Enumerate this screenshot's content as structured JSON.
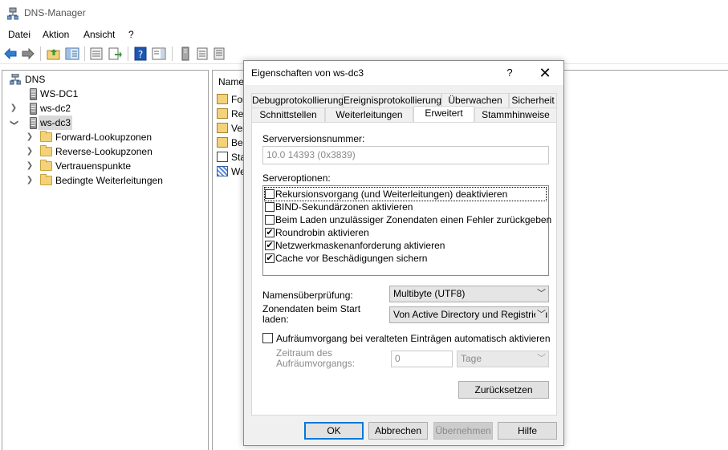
{
  "app": {
    "title": "DNS-Manager",
    "icon": "dns-manager-icon"
  },
  "menu": [
    "Datei",
    "Aktion",
    "Ansicht",
    "?"
  ],
  "toolbar": {
    "icons": [
      "back-arrow-icon",
      "forward-arrow-icon",
      "up-folder-icon",
      "show-hide-tree-icon",
      "properties-icon",
      "export-list-icon",
      "help-icon",
      "action-pane-icon",
      "server-icon",
      "records-icon",
      "list-icon"
    ]
  },
  "tree": {
    "root": "DNS",
    "servers": [
      "WS-DC1",
      "ws-dc2",
      "ws-dc3"
    ],
    "children": [
      "Forward-Lookupzonen",
      "Reverse-Lookupzonen",
      "Vertrauenspunkte",
      "Bedingte Weiterleitungen"
    ]
  },
  "list": {
    "header": "Name",
    "items": [
      "For",
      "Rev",
      "Ver",
      "Bed",
      "Sta",
      "We"
    ]
  },
  "dialog": {
    "title": "Eigenschaften von ws-dc3",
    "help": "?",
    "close": "✕",
    "tabs_row1": [
      "Debugprotokollierung",
      "Ereignisprotokollierung",
      "Überwachen",
      "Sicherheit"
    ],
    "tabs_row2": [
      "Schnittstellen",
      "Weiterleitungen",
      "Erweitert",
      "Stammhinweise"
    ],
    "active_tab": "Erweitert",
    "server_version_label": "Serverversionsnummer:",
    "server_version_value": "10.0 14393 (0x3839)",
    "server_options_label": "Serveroptionen:",
    "options": [
      {
        "label": "Rekursionsvorgang (und Weiterleitungen) deaktivieren",
        "checked": false
      },
      {
        "label": "BIND-Sekundärzonen aktivieren",
        "checked": false
      },
      {
        "label": "Beim Laden unzulässiger Zonendaten einen Fehler zurückgeben",
        "checked": false
      },
      {
        "label": "Roundrobin aktivieren",
        "checked": true
      },
      {
        "label": "Netzwerkmaskenanforderung aktivieren",
        "checked": true
      },
      {
        "label": "Cache vor Beschädigungen sichern",
        "checked": true
      }
    ],
    "name_check_label": "Namensüberprüfung:",
    "name_check_value": "Multibyte (UTF8)",
    "zone_load_label_1": "Zonendaten beim Start",
    "zone_load_label_2": "laden:",
    "zone_load_value": "Von Active Directory und Registrierung",
    "scavenging_label": "Aufräumvorgang bei veralteten Einträgen automatisch aktivieren",
    "scavenging_checked": false,
    "period_label_1": "Zeitraum des",
    "period_label_2": "Aufräumvorgangs:",
    "period_value": "0",
    "period_unit": "Tage",
    "reset_button": "Zurücksetzen",
    "ok_button": "OK",
    "cancel_button": "Abbrechen",
    "apply_button": "Übernehmen",
    "help_button": "Hilfe"
  },
  "colors": {
    "accent": "#0078d7",
    "folder": "#f3d27a",
    "dialog_bg": "#f0f0f0"
  }
}
